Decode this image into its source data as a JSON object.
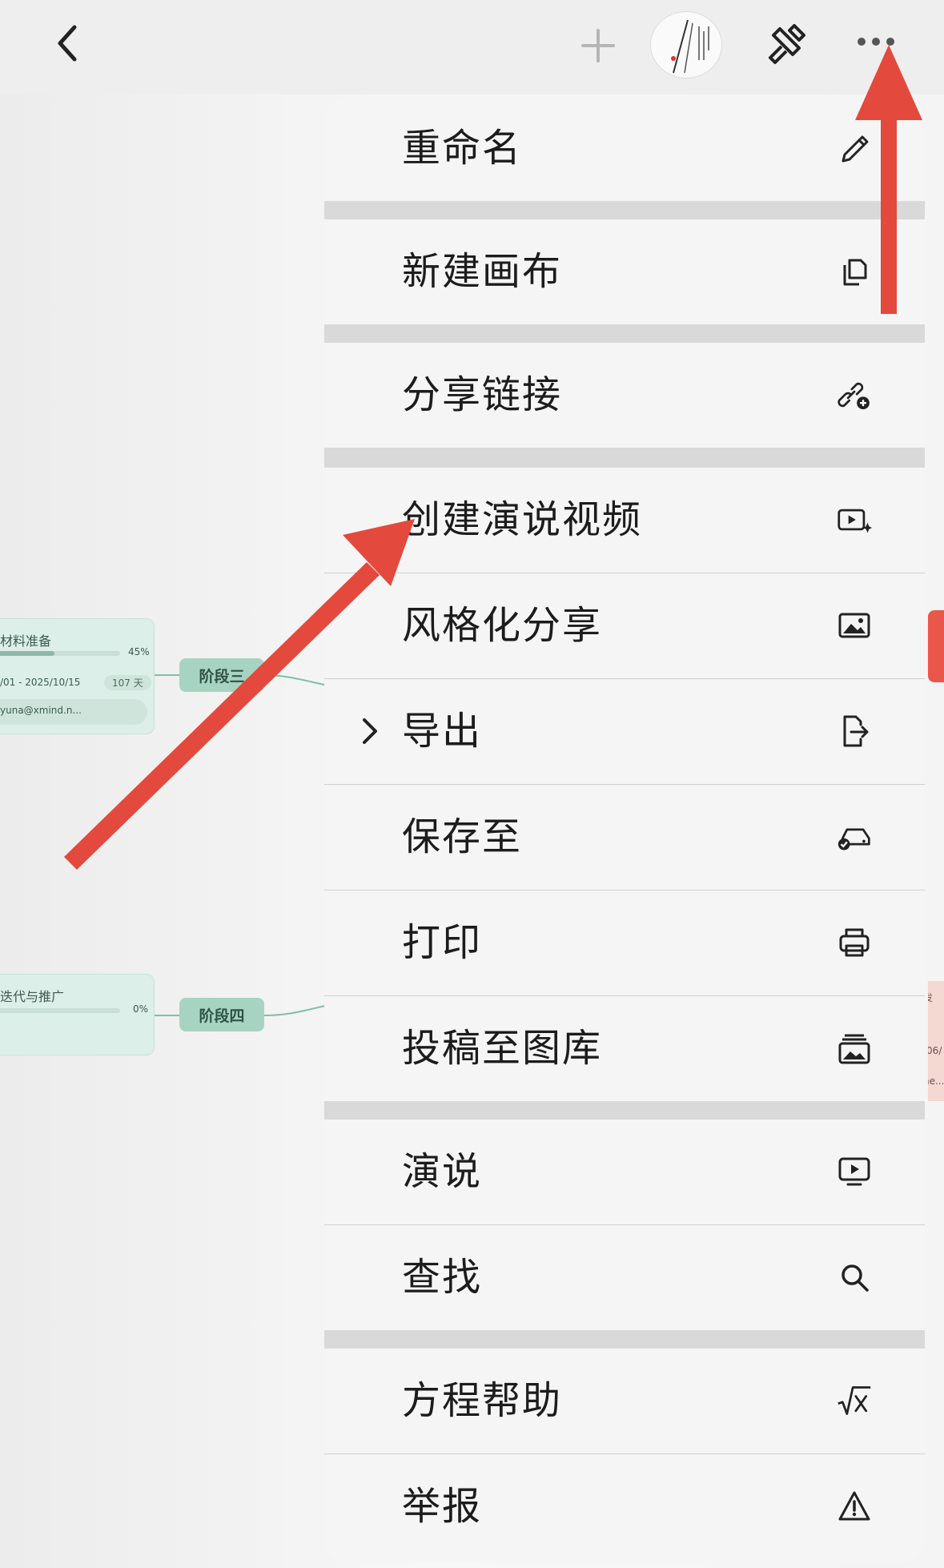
{
  "toolbar": {
    "back_icon": "chevron-left-icon",
    "add_icon": "plus-icon",
    "avatar_icon": "canvas-thumbnail",
    "style_icon": "paintbrush-icon",
    "more_icon": "ellipsis-icon"
  },
  "canvas": {
    "card1": {
      "title": "材料准备",
      "progress_text": "45%",
      "progress": 0.45,
      "dates": "/01 - 2025/10/15",
      "days": "107 天",
      "assignee": "yuna@xmind.n..."
    },
    "card2": {
      "title": "迭代与推广",
      "progress_text": "0%",
      "progress": 0
    },
    "stage3": "阶段三",
    "stage4": "阶段四",
    "right_peek": {
      "text1": "发",
      "text2": "/06/",
      "text3": "ne..."
    }
  },
  "menu": {
    "items": [
      {
        "label": "重命名",
        "icon": "pencil-icon"
      },
      {
        "label": "新建画布",
        "icon": "duplicate-icon"
      },
      {
        "label": "分享链接",
        "icon": "link-add-icon"
      },
      {
        "label": "创建演说视频",
        "icon": "video-sparkle-icon"
      },
      {
        "label": "风格化分享",
        "icon": "image-icon"
      },
      {
        "label": "导出",
        "icon": "export-icon"
      },
      {
        "label": "保存至",
        "icon": "drive-check-icon"
      },
      {
        "label": "打印",
        "icon": "printer-icon"
      },
      {
        "label": "投稿至图库",
        "icon": "gallery-icon"
      },
      {
        "label": "演说",
        "icon": "presentation-play-icon"
      },
      {
        "label": "查找",
        "icon": "search-icon"
      },
      {
        "label": "方程帮助",
        "icon": "sqrt-x-icon"
      },
      {
        "label": "举报",
        "icon": "warning-icon"
      }
    ]
  },
  "colors": {
    "annotation_arrow": "#e4493d",
    "stage_node": "#a7d4c2",
    "menu_background": "#f5f5f5"
  }
}
